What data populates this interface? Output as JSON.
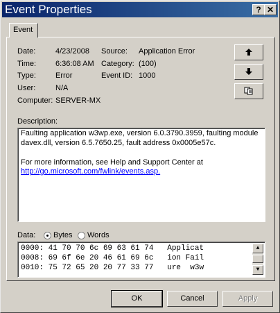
{
  "window": {
    "title": "Event Properties",
    "help_button": "?",
    "close_button": "✕"
  },
  "tabs": [
    {
      "label": "Event"
    }
  ],
  "fields": {
    "date_label": "Date:",
    "date_value": "4/23/2008",
    "time_label": "Time:",
    "time_value": "6:36:08 AM",
    "type_label": "Type:",
    "type_value": "Error",
    "user_label": "User:",
    "user_value": "N/A",
    "computer_label": "Computer:",
    "computer_value": "SERVER-MX",
    "source_label": "Source:",
    "source_value": "Application Error",
    "category_label": "Category:",
    "category_value": "(100)",
    "eventid_label": "Event ID:",
    "eventid_value": "1000"
  },
  "nav": {
    "up_icon": "arrow-up-icon",
    "down_icon": "arrow-down-icon",
    "copy_icon": "copy-icon"
  },
  "description": {
    "label": "Description:",
    "line1": "Faulting application w3wp.exe, version 6.0.3790.3959, faulting module",
    "line2": "davex.dll, version 6.5.7650.25, fault address 0x0005e57c.",
    "line3": "For more information, see Help and Support Center at",
    "link": "http://go.microsoft.com/fwlink/events.asp."
  },
  "data_section": {
    "label": "Data:",
    "bytes_label": "Bytes",
    "words_label": "Words",
    "selected": "Bytes",
    "rows": [
      "0000: 41 70 70 6c 69 63 61 74   Applicat",
      "0008: 69 6f 6e 20 46 61 69 6c   ion Fail",
      "0010: 75 72 65 20 20 77 33 77   ure  w3w"
    ]
  },
  "buttons": {
    "ok": "OK",
    "cancel": "Cancel",
    "apply": "Apply"
  }
}
